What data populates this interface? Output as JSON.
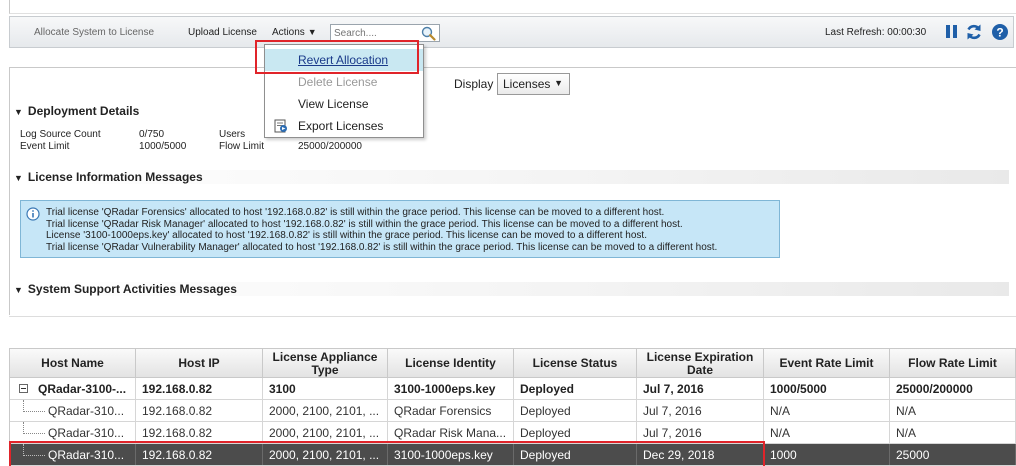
{
  "toolbar": {
    "allocate_label": "Allocate System to License",
    "upload_label": "Upload License",
    "actions_label": "Actions",
    "search_placeholder": "Search....",
    "last_refresh": "Last Refresh: 00:00:30",
    "icons": {
      "pause": "pause-icon",
      "refresh": "refresh-icon",
      "help": "help-icon"
    }
  },
  "actions_menu": {
    "items": [
      {
        "label": "Revert Allocation",
        "state": "hover"
      },
      {
        "label": "Delete License",
        "state": "disabled"
      },
      {
        "label": "View License",
        "state": "normal"
      },
      {
        "label": "Export Licenses",
        "state": "normal",
        "icon": "export-icon"
      }
    ]
  },
  "display": {
    "label": "Display",
    "selected": "Licenses"
  },
  "deployment": {
    "title": "Deployment Details",
    "log_source_label": "Log Source Count",
    "log_source_value": "0/750",
    "event_limit_label": "Event Limit",
    "event_limit_value": "1000/5000",
    "users_label": "Users",
    "flow_limit_label": "Flow Limit",
    "flow_limit_value": "25000/200000"
  },
  "license_messages": {
    "title": "License Information Messages",
    "lines": [
      "Trial license 'QRadar Forensics' allocated to host '192.168.0.82' is still within the grace period. This license can be moved to a different host.",
      "Trial license 'QRadar Risk Manager' allocated to host '192.168.0.82' is still within the grace period. This license can be moved to a different host.",
      "License '3100-1000eps.key' allocated to host '192.168.0.82' is still within the grace period. This license can be moved to a different host.",
      "Trial license 'QRadar Vulnerability Manager' allocated to host '192.168.0.82' is still within the grace period. This license can be moved to a different host."
    ]
  },
  "support_messages": {
    "title": "System Support Activities Messages"
  },
  "table": {
    "columns": [
      "Host Name",
      "Host IP",
      "License Appliance Type",
      "License Identity",
      "License Status",
      "License Expiration Date",
      "Event Rate Limit",
      "Flow Rate Limit"
    ],
    "rows": [
      [
        "QRadar-3100-...",
        "192.168.0.82",
        "3100",
        "3100-1000eps.key",
        "Deployed",
        "Jul 7, 2016",
        "1000/5000",
        "25000/200000"
      ],
      [
        "QRadar-310...",
        "192.168.0.82",
        "2000, 2100, 2101, ...",
        "QRadar Forensics",
        "Deployed",
        "Jul 7, 2016",
        "N/A",
        "N/A"
      ],
      [
        "QRadar-310...",
        "192.168.0.82",
        "2000, 2100, 2101, ...",
        "QRadar Risk Mana...",
        "Deployed",
        "Jul 7, 2016",
        "N/A",
        "N/A"
      ],
      [
        "QRadar-310...",
        "192.168.0.82",
        "2000, 2100, 2101, ...",
        "3100-1000eps.key",
        "Deployed",
        "Dec 29, 2018",
        "1000",
        "25000"
      ]
    ],
    "selected_row": 3
  },
  "colors": {
    "selection": "#4c4c4c",
    "menu_hover": "#c9e8f2",
    "info_box": "#c6e6f7",
    "annotation": "#e0242a"
  }
}
